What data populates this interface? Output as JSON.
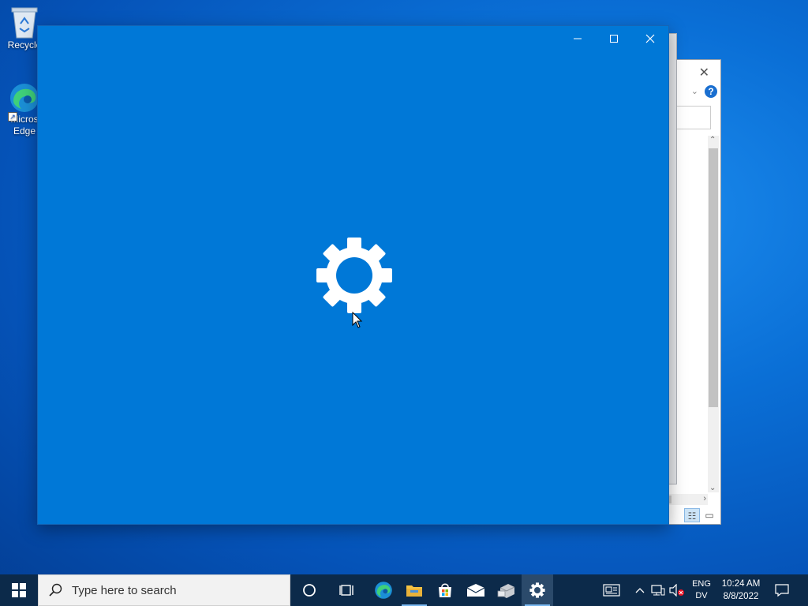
{
  "desktop": {
    "icons": [
      {
        "label": "Recycle",
        "icon": "recycle-bin-icon"
      },
      {
        "label": "Micros\nEdge",
        "icon": "edge-icon"
      }
    ]
  },
  "settings_window": {
    "caption": {
      "minimize": "—",
      "maximize": "☐",
      "close": "✕"
    },
    "splash_icon": "gear-icon",
    "background_color": "#0078d7"
  },
  "background_window": {
    "close": "✕",
    "help": "?",
    "chevron": "⌄"
  },
  "taskbar": {
    "search_placeholder": "Type here to search",
    "apps": [
      {
        "name": "cortana",
        "icon": "cortana-circle-icon"
      },
      {
        "name": "task-view",
        "icon": "task-view-icon"
      },
      {
        "name": "edge",
        "icon": "edge-icon"
      },
      {
        "name": "file-explorer",
        "icon": "folder-icon"
      },
      {
        "name": "store",
        "icon": "store-icon"
      },
      {
        "name": "mail",
        "icon": "mail-icon"
      },
      {
        "name": "app",
        "icon": "app-icon"
      },
      {
        "name": "settings",
        "icon": "gear-icon",
        "active": true
      }
    ],
    "tray": {
      "language_line1": "ENG",
      "language_line2": "DV",
      "time": "10:24 AM",
      "date": "8/8/2022"
    }
  },
  "colors": {
    "accent": "#0078d7",
    "taskbar": "#0c2a4a"
  }
}
